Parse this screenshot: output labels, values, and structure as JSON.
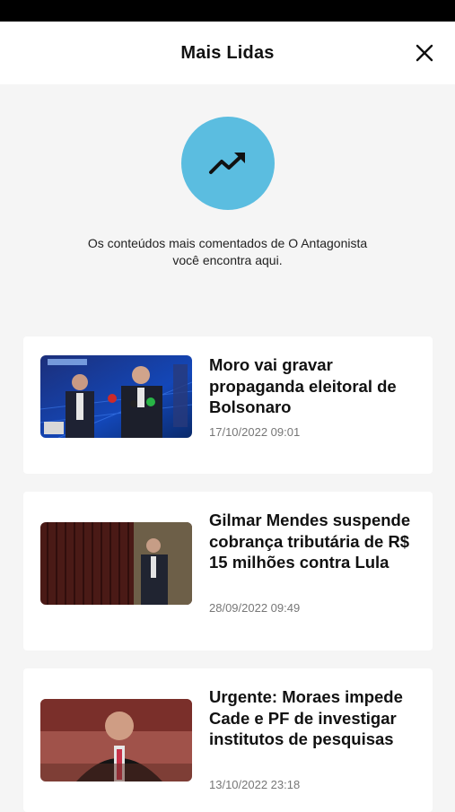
{
  "header": {
    "title": "Mais Lidas"
  },
  "intro": {
    "line1": "Os conteúdos mais comentados de O Antagonista",
    "line2": "você encontra aqui."
  },
  "colors": {
    "accent": "#5bbde0",
    "background": "#f5f5f5",
    "date_text": "#777777"
  },
  "articles": [
    {
      "title": "Moro vai gravar propaganda eleitoral de Bolsonaro",
      "date": "17/10/2022 09:01"
    },
    {
      "title": "Gilmar Mendes suspende cobrança tributária de R$ 15 milhões contra Lula",
      "date": "28/09/2022 09:49"
    },
    {
      "title": "Urgente: Moraes impede Cade e PF de investigar institutos de pesquisas",
      "date": "13/10/2022 23:18"
    }
  ]
}
